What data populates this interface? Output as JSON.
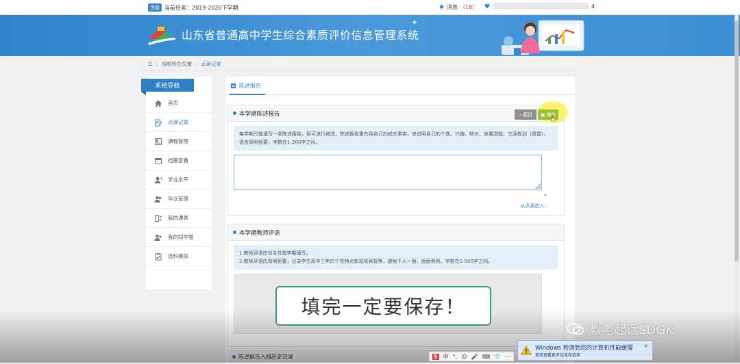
{
  "topbar": {
    "term_tag": "当前",
    "term_text": "当前任务：2019-2020下学期",
    "msg_label": "消息",
    "msg_count": "（18）",
    "user_suffix": "4"
  },
  "header": {
    "title": "山东省普通高中学生综合素质评价信息管理系统"
  },
  "breadcrumb": {
    "location": "当前所在位置",
    "current": "点滴记录"
  },
  "sidebar": {
    "heading": "系统导航",
    "items": [
      {
        "label": "首页",
        "icon": "home-icon"
      },
      {
        "label": "点滴记录",
        "icon": "edit-icon"
      },
      {
        "label": "课程管理",
        "icon": "course-icon"
      },
      {
        "label": "档案查看",
        "icon": "archive-icon"
      },
      {
        "label": "学业水平",
        "icon": "user-icon"
      },
      {
        "label": "毕业管理",
        "icon": "users-icon"
      },
      {
        "label": "我的课表",
        "icon": "schedule-icon"
      },
      {
        "label": "我的同学圈",
        "icon": "classmates-icon"
      },
      {
        "label": "选科模拟",
        "icon": "checklist-icon"
      }
    ]
  },
  "main": {
    "tab": "陈述报告",
    "statement": {
      "title": "本学期陈述报告",
      "back": "返回",
      "save": "保存",
      "notice": "每学期只能填写一条陈述报告，但可进行修改，陈述报告重在用自己的成长事实，来说明自己的个性、兴趣、特长、发展潜能、生涯规划（愿望），语言简明扼要，字数在1-200字之间。",
      "textarea_value": "",
      "required_mark": "*",
      "import_link": "从点滴选入..."
    },
    "teacher_comment": {
      "title": "本学期教师评语",
      "notice_line1": "1.教师评语由班主任按学期填写。",
      "notice_line2": "2.教师评语应简明扼要，记录学生高中三年的个性特点和现实表现等，避免千人一面，面面俱到。字数在1-500字之间。"
    },
    "history_title": "陈述报告入档历史记录"
  },
  "overlay": {
    "text": "填完一定要保存！"
  },
  "watermark": {
    "text": "教老起话SDGK"
  },
  "ime": {
    "items": [
      "S",
      "中",
      "°,",
      "☺",
      "🎤",
      "⌨",
      "👕",
      "⋯"
    ]
  },
  "toast": {
    "line1": "Windows 检测到您的计算机性能缓慢",
    "line2": "单击查看更多信息和选项",
    "close": "×"
  }
}
